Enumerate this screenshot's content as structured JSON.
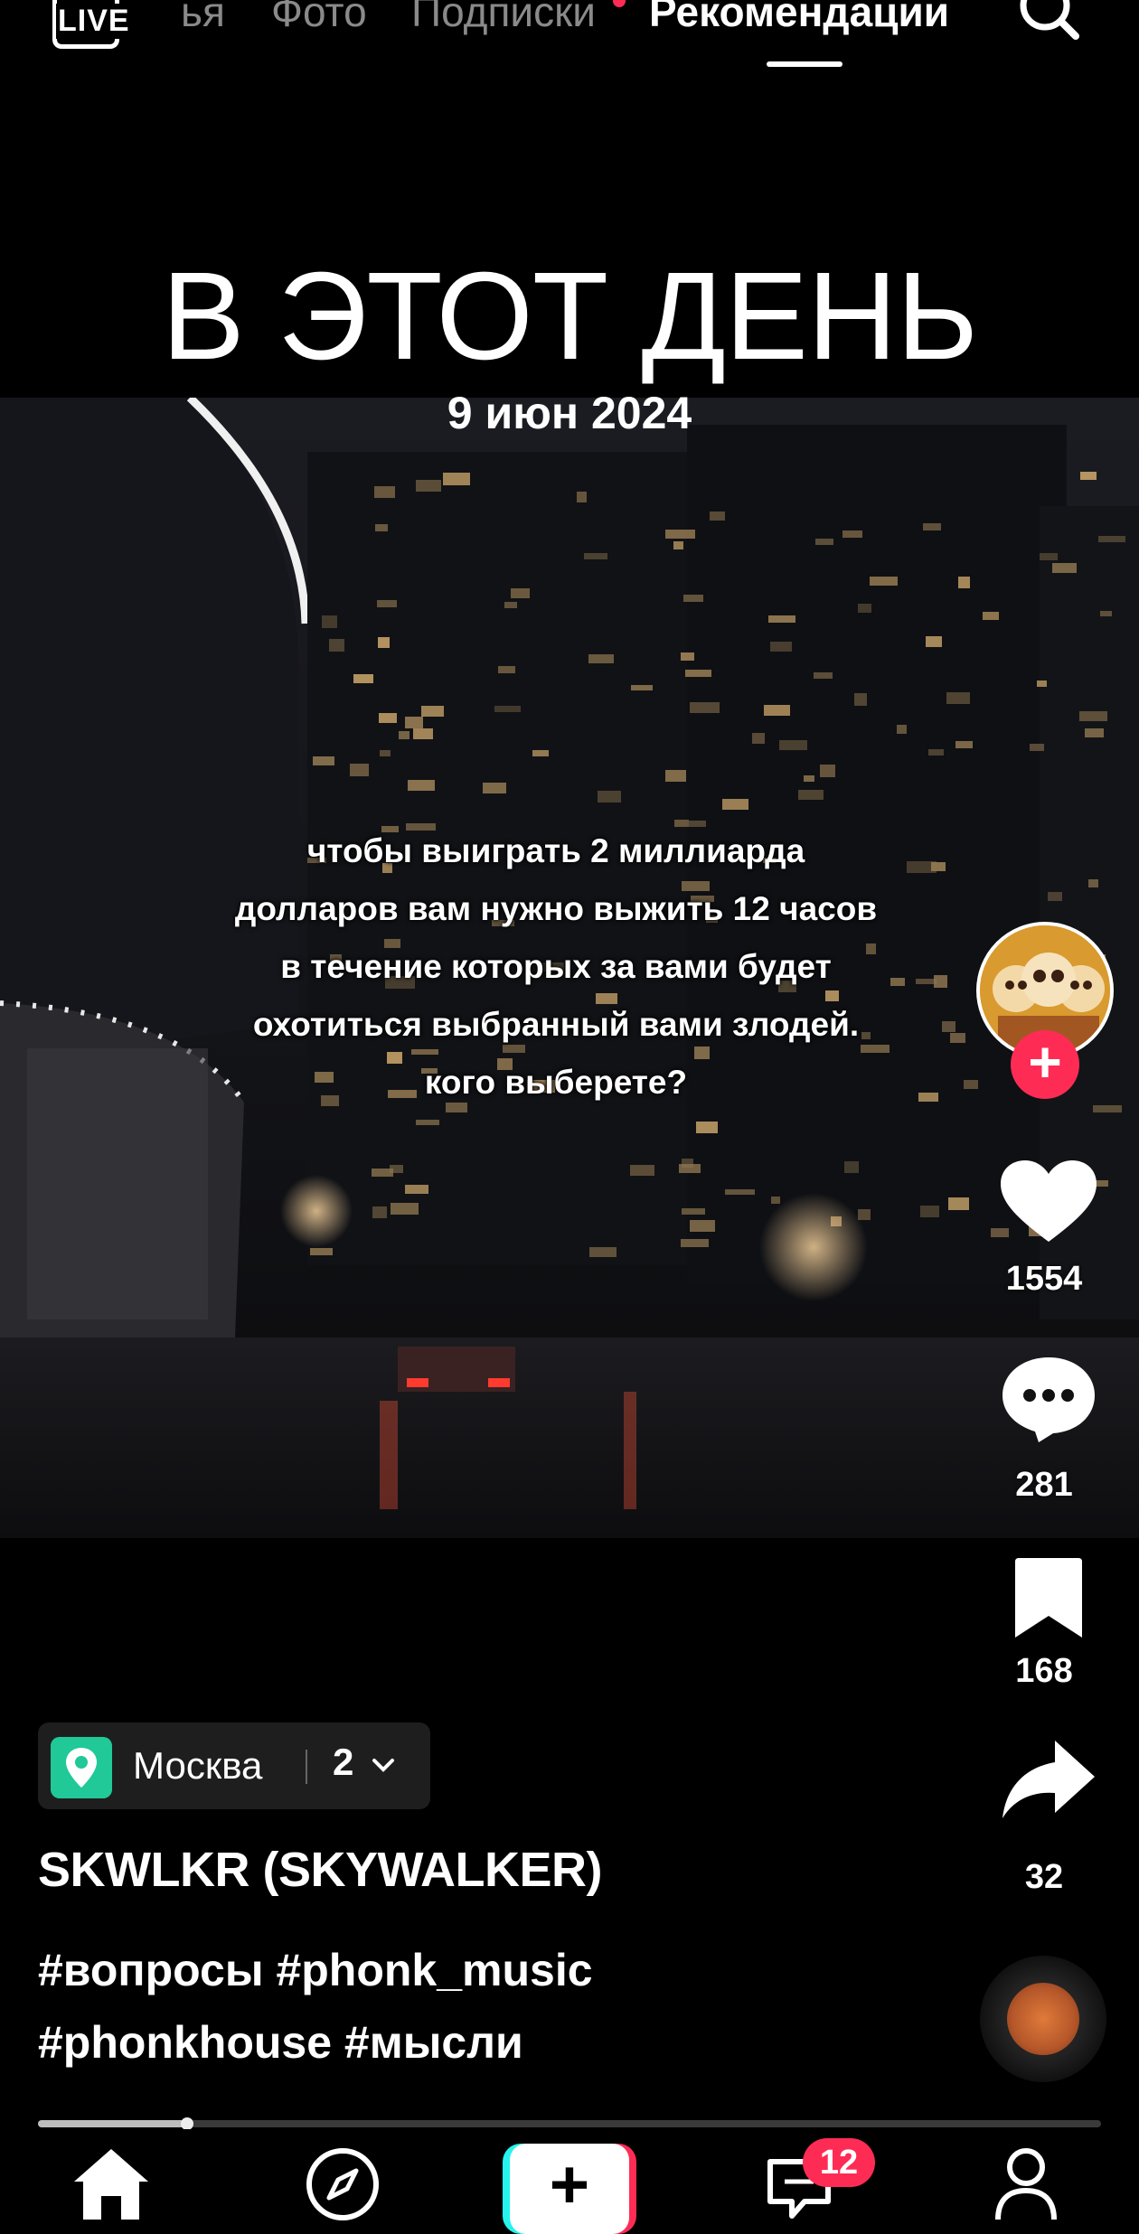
{
  "top_nav": {
    "live_label": "LIVE",
    "tabs": [
      {
        "label": "ья",
        "active": false
      },
      {
        "label": "Фото",
        "active": false
      },
      {
        "label": "Подписки",
        "active": false,
        "has_dot": true
      },
      {
        "label": "Рекомендации",
        "active": true
      }
    ],
    "search_icon": "search-icon"
  },
  "memory": {
    "title": "В ЭТОТ ДЕНЬ",
    "date": "9 июн 2024"
  },
  "video": {
    "caption_lines": [
      "чтобы выиграть 2 миллиарда",
      "долларов вам нужно выжить 12 часов",
      "в течение которых за вами будет",
      "охотиться выбранный вами злодей.",
      "кого выберете?"
    ]
  },
  "rail": {
    "follow_symbol": "+",
    "likes": "1554",
    "comments": "281",
    "saves": "168",
    "shares": "32"
  },
  "info": {
    "location": "Москва",
    "location_count": "2",
    "author": "SKWLKR (SKYWALKER)",
    "hashtags_line1": "#вопросы #phonk_music",
    "hashtags_line2": "#phonkhouse #мысли",
    "progress": 0.14
  },
  "bottom_nav": {
    "create_symbol": "+",
    "inbox_badge": "12",
    "icons": [
      "home-icon",
      "discover-icon",
      "create-icon",
      "inbox-icon",
      "profile-icon"
    ]
  },
  "colors": {
    "accent_red": "#fe2c55",
    "accent_cyan": "#25f4ee",
    "location_green": "#20c997"
  }
}
